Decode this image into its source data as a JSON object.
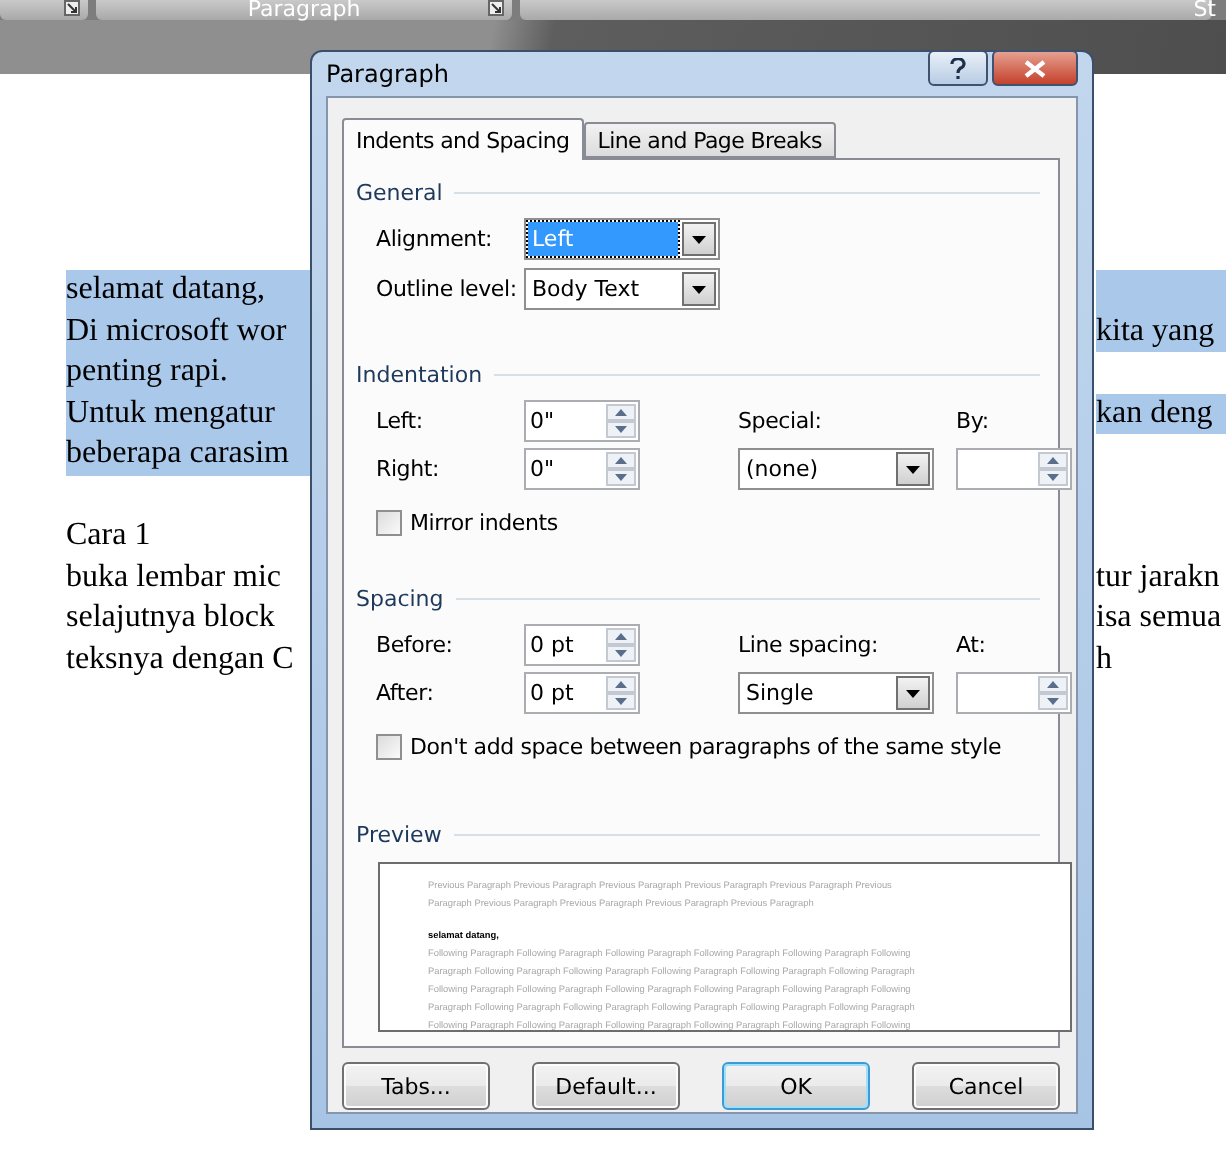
{
  "ribbon": {
    "groups": [
      {
        "label": "Paragraph"
      },
      {
        "label": "St"
      }
    ]
  },
  "document": {
    "blocks": [
      {
        "lines": [
          {
            "left": "selamat datang,",
            "selected": true,
            "right_selected": true
          },
          {
            "left": "Di microsoft wor",
            "right": "kita yang",
            "selected": true,
            "right_selected": true
          },
          {
            "left": "penting rapi.",
            "selected": true,
            "right_selected": false
          },
          {
            "left": "Untuk mengatur",
            "right": "kan deng",
            "selected": true,
            "right_selected": true
          },
          {
            "left": "beberapa carasim",
            "selected": true,
            "right_selected": false
          }
        ]
      },
      {
        "lines": [
          {
            "left": "Cara 1",
            "selected": false,
            "right_selected": false
          },
          {
            "left": "buka lembar mic",
            "right": "tur jarakn",
            "selected": false,
            "right_selected": false
          },
          {
            "left": "selajutnya block",
            "right": "isa semua",
            "selected": false,
            "right_selected": false
          },
          {
            "left": "teksnya dengan C",
            "right": "h",
            "selected": false,
            "right_selected": false
          }
        ]
      }
    ]
  },
  "dialog": {
    "title": "Paragraph",
    "tabs": [
      {
        "label": "Indents and Spacing",
        "selected": true
      },
      {
        "label": "Line and Page Breaks",
        "selected": false
      }
    ],
    "general": {
      "heading": "General",
      "alignment": {
        "label": "Alignment:",
        "value": "Left",
        "highlighted": true
      },
      "outline_level": {
        "label": "Outline level:",
        "value": "Body Text",
        "highlighted": false
      }
    },
    "indentation": {
      "heading": "Indentation",
      "left": {
        "label": "Left:",
        "value": "0\""
      },
      "right": {
        "label": "Right:",
        "value": "0\""
      },
      "special": {
        "label": "Special:",
        "value": "(none)",
        "highlighted": false
      },
      "by": {
        "label": "By:"
      },
      "mirror_indents": {
        "label": "Mirror indents",
        "checked": false
      }
    },
    "spacing": {
      "heading": "Spacing",
      "before": {
        "label": "Before:",
        "value": "0 pt"
      },
      "after": {
        "label": "After:",
        "value": "0 pt"
      },
      "line_spacing": {
        "label": "Line spacing:",
        "value": "Single",
        "highlighted": false
      },
      "at": {
        "label": "At:"
      },
      "dont_add_space": {
        "label": "Don't add space between paragraphs of the same style",
        "checked": false
      }
    },
    "preview": {
      "heading": "Preview",
      "lines": [
        {
          "kind": "other",
          "text": "Previous Paragraph Previous Paragraph Previous Paragraph Previous Paragraph Previous Paragraph Previous"
        },
        {
          "kind": "other",
          "text": "Paragraph Previous Paragraph Previous Paragraph Previous Paragraph Previous Paragraph"
        },
        {
          "kind": "sample",
          "text": "selamat datang,"
        },
        {
          "kind": "other",
          "text": "Following Paragraph Following Paragraph Following Paragraph Following Paragraph Following Paragraph Following"
        },
        {
          "kind": "other",
          "text": "Paragraph Following Paragraph Following Paragraph Following Paragraph Following Paragraph Following Paragraph"
        },
        {
          "kind": "other",
          "text": "Following Paragraph Following Paragraph Following Paragraph Following Paragraph Following Paragraph Following"
        },
        {
          "kind": "other",
          "text": "Paragraph Following Paragraph Following Paragraph Following Paragraph Following Paragraph Following Paragraph"
        },
        {
          "kind": "other",
          "text": "Following Paragraph Following Paragraph Following Paragraph Following Paragraph Following Paragraph Following"
        }
      ]
    },
    "buttons": [
      {
        "label": "Tabs...",
        "default": false
      },
      {
        "label": "Default...",
        "default": false
      },
      {
        "label": "OK",
        "default": true
      },
      {
        "label": "Cancel",
        "default": false
      }
    ]
  }
}
